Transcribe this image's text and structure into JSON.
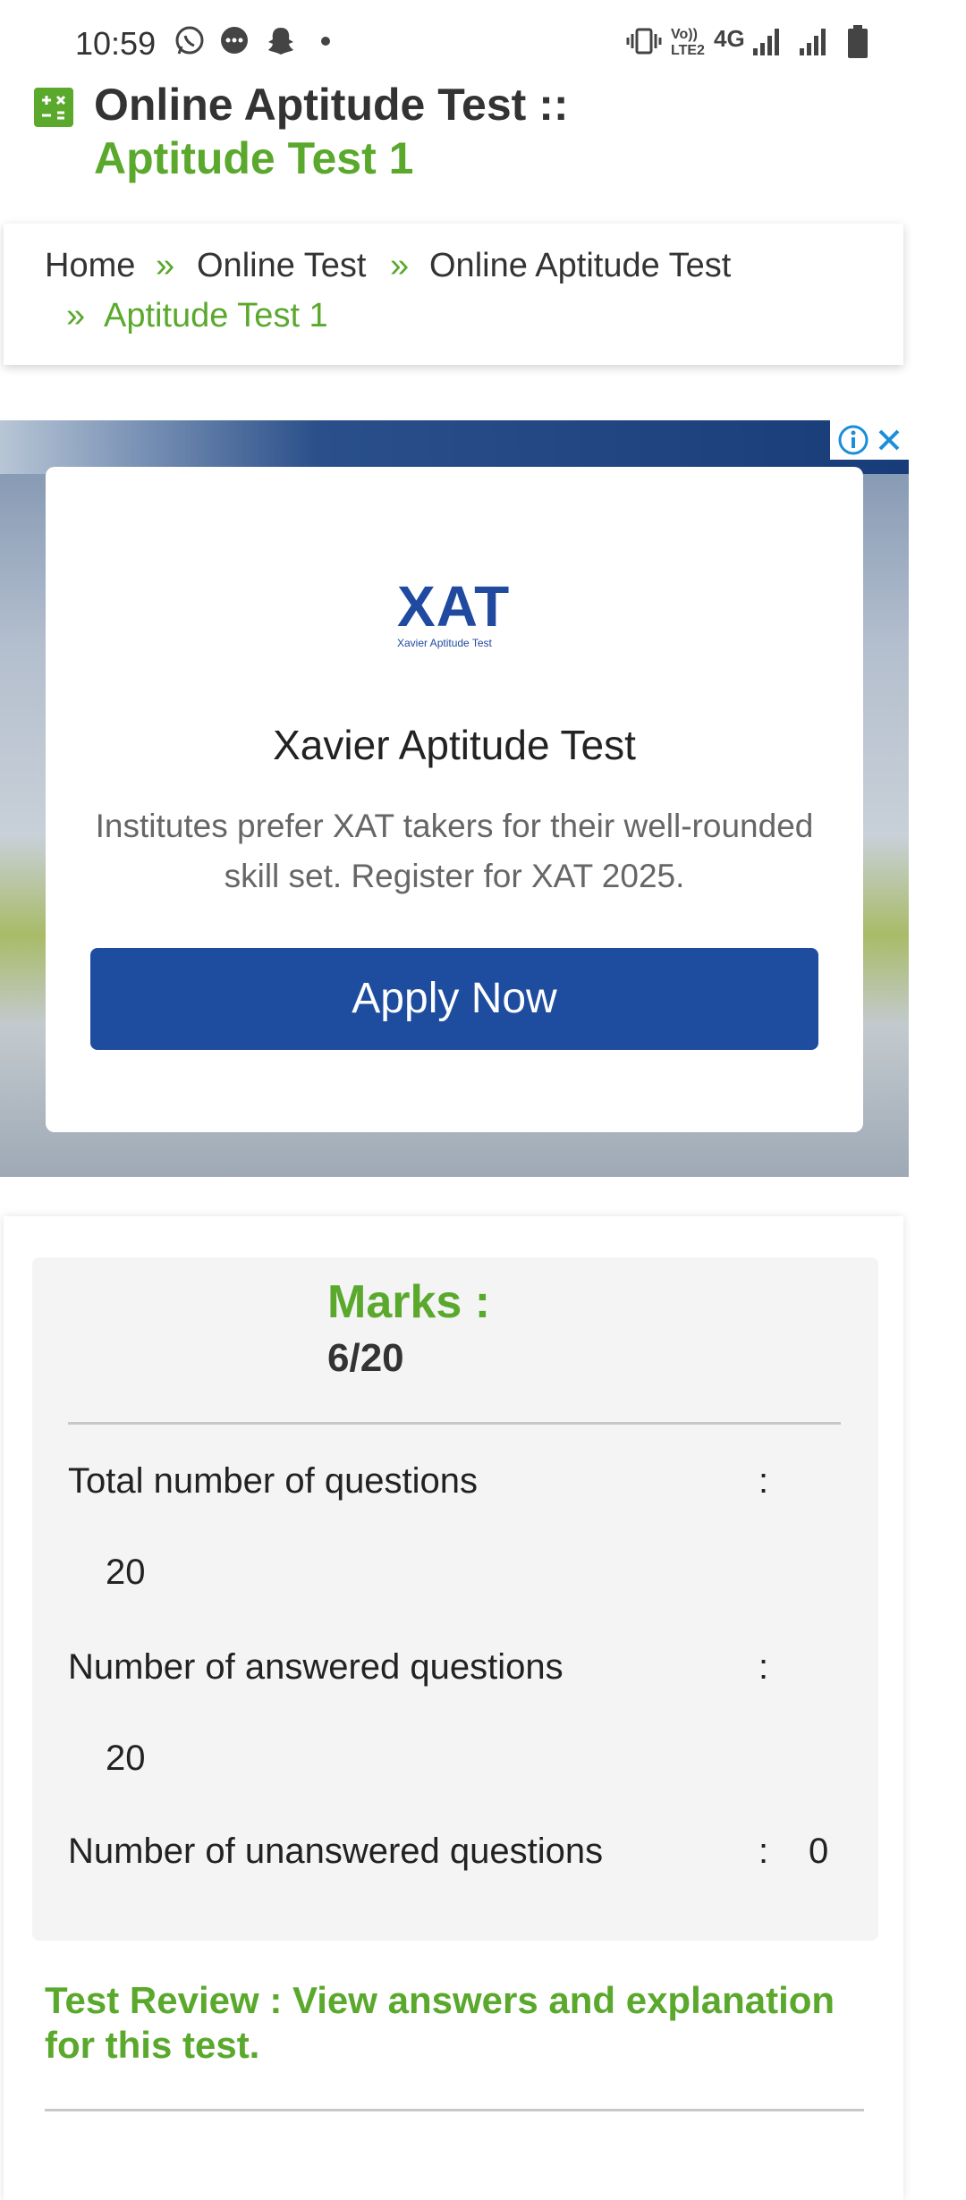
{
  "status_bar": {
    "time": "10:59",
    "left_icons": [
      "whatsapp-icon",
      "messages-icon",
      "snapchat-icon",
      "dot-icon"
    ],
    "right_text_volte": "Vo)) LTE2",
    "network": "4G",
    "right_icons": [
      "vibrate-icon",
      "signal-1-icon",
      "signal-2-icon",
      "battery-icon"
    ]
  },
  "header": {
    "title_line1": "Online Aptitude Test ::",
    "title_line2": "Aptitude Test 1"
  },
  "breadcrumb": {
    "items": [
      "Home",
      "Online Test",
      "Online Aptitude Test",
      "Aptitude Test 1"
    ],
    "separator": "»"
  },
  "ad": {
    "logo_main": "XAT",
    "logo_sub": "Xavier Aptitude Test",
    "title": "Xavier Aptitude Test",
    "description": "Institutes prefer XAT takers for their well-rounded skill set. Register for XAT 2025.",
    "cta": "Apply Now"
  },
  "results": {
    "marks_label": "Marks :",
    "marks_value": "6/20",
    "rows": [
      {
        "label": "Total number of questions",
        "colon": ":",
        "value": "20"
      },
      {
        "label": "Number of answered questions",
        "colon": ":",
        "value": "20"
      },
      {
        "label": "Number of unanswered questions",
        "colon": ":",
        "value": "0"
      }
    ],
    "review_link": "Test Review : View answers and explanation for this test."
  },
  "colors": {
    "accent_green": "#5aa82c",
    "ad_button_blue": "#1e4da0"
  }
}
